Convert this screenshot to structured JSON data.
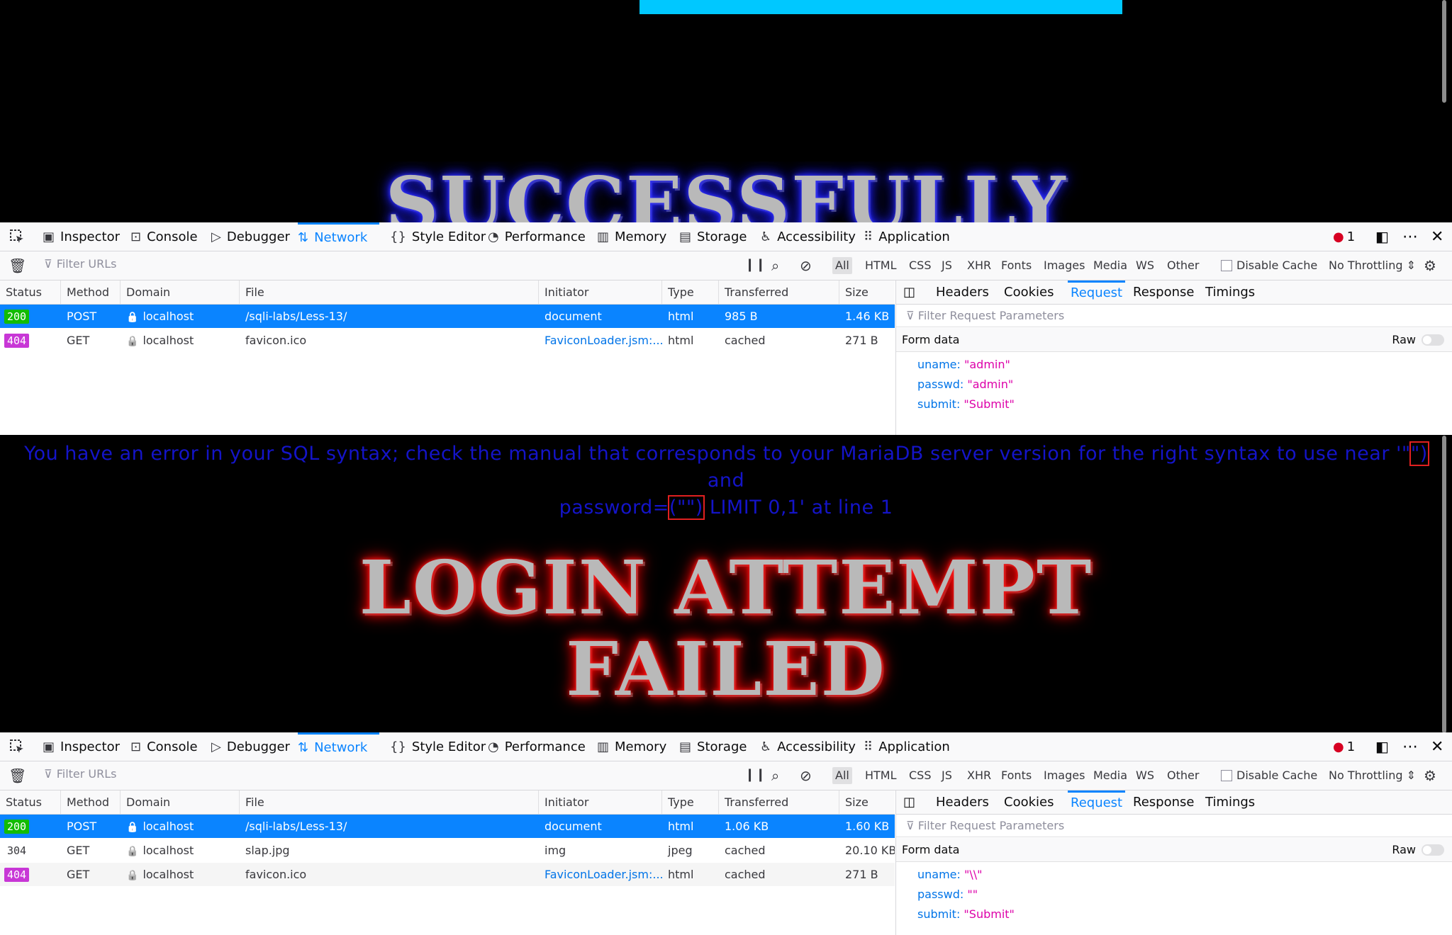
{
  "page": {
    "success_text": "SUCCESSFULLY",
    "sql_error_line1_before": "You have an error in your SQL syntax; check the manual that corresponds to your MariaDB server version for the right syntax to use near '\"",
    "sql_error_line1_hl": "\")",
    "sql_error_line1_after": " and",
    "sql_error_line2_before": "password=",
    "sql_error_line2_hl": "(\"\")",
    "sql_error_line2_after": " LIMIT 0,1' at line 1",
    "login_failed_line1": "LOGIN ATTEMPT",
    "login_failed_line2": "FAILED",
    "colors": {
      "cyan_bar": "#00c8ff",
      "error_text": "#1414c8",
      "highlight_box": "#e02020"
    }
  },
  "devtools": {
    "tabs": [
      "Inspector",
      "Console",
      "Debugger",
      "Network",
      "Style Editor",
      "Performance",
      "Memory",
      "Storage",
      "Accessibility",
      "Application"
    ],
    "active_tab": "Network",
    "error_count": "1",
    "filter_placeholder": "Filter URLs",
    "type_filters": [
      "All",
      "HTML",
      "CSS",
      "JS",
      "XHR",
      "Fonts",
      "Images",
      "Media",
      "WS",
      "Other"
    ],
    "disable_cache": "Disable Cache",
    "throttling": "No Throttling",
    "columns": [
      "Status",
      "Method",
      "Domain",
      "File",
      "Initiator",
      "Type",
      "Transferred",
      "Size"
    ],
    "side_tabs": [
      "Headers",
      "Cookies",
      "Request",
      "Response",
      "Timings"
    ],
    "side_active": "Request",
    "side_filter": "Filter Request Parameters",
    "form_data_label": "Form data",
    "raw_label": "Raw"
  },
  "panel1": {
    "rows": [
      {
        "status": "200",
        "method": "POST",
        "domain": "localhost",
        "file": "/sqli-labs/Less-13/",
        "initiator": "document",
        "type": "html",
        "transferred": "985 B",
        "size": "1.46 KB"
      },
      {
        "status": "404",
        "method": "GET",
        "domain": "localhost",
        "file": "favicon.ico",
        "initiator": "FaviconLoader.jsm:...",
        "type": "html",
        "transferred": "cached",
        "size": "271 B"
      }
    ],
    "params": [
      {
        "key": "uname:",
        "value": "\"admin\""
      },
      {
        "key": "passwd:",
        "value": "\"admin\""
      },
      {
        "key": "submit:",
        "value": "\"Submit\""
      }
    ]
  },
  "panel2": {
    "rows": [
      {
        "status": "200",
        "method": "POST",
        "domain": "localhost",
        "file": "/sqli-labs/Less-13/",
        "initiator": "document",
        "type": "html",
        "transferred": "1.06 KB",
        "size": "1.60 KB"
      },
      {
        "status": "304",
        "method": "GET",
        "domain": "localhost",
        "file": "slap.jpg",
        "initiator": "img",
        "type": "jpeg",
        "transferred": "cached",
        "size": "20.10 KB"
      },
      {
        "status": "404",
        "method": "GET",
        "domain": "localhost",
        "file": "favicon.ico",
        "initiator": "FaviconLoader.jsm:...",
        "type": "html",
        "transferred": "cached",
        "size": "271 B"
      }
    ],
    "params": [
      {
        "key": "uname:",
        "value": "\"\\\\\""
      },
      {
        "key": "passwd:",
        "value": "\"\""
      },
      {
        "key": "submit:",
        "value": "\"Submit\""
      }
    ]
  }
}
